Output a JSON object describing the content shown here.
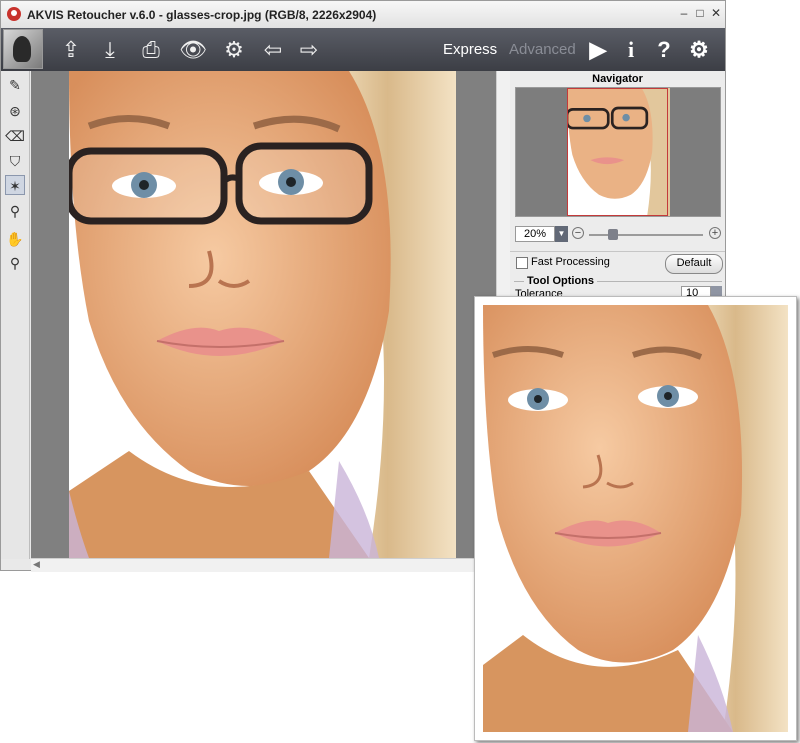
{
  "window": {
    "title": "AKVIS Retoucher v.6.0 - glasses-crop.jpg (RGB/8, 2226x2904)",
    "controls": [
      "–",
      "□",
      "✕"
    ]
  },
  "toolbar": {
    "buttons": [
      {
        "name": "open-icon",
        "glyph": "⇪"
      },
      {
        "name": "save-icon",
        "glyph": "⤓"
      },
      {
        "name": "print-icon",
        "glyph": "⎙"
      },
      {
        "name": "preferences-eye-icon",
        "glyph": "👁"
      },
      {
        "name": "run-gear-icon",
        "glyph": "⚙"
      },
      {
        "name": "back-arrow-icon",
        "glyph": "⇦"
      },
      {
        "name": "forward-arrow-icon",
        "glyph": "⇨"
      }
    ],
    "mode_express": "Express",
    "mode_advanced": "Advanced",
    "right_icons": [
      {
        "name": "play-icon",
        "glyph": "▶"
      },
      {
        "name": "info-icon",
        "glyph": "i"
      },
      {
        "name": "help-icon",
        "glyph": "?"
      },
      {
        "name": "settings-gear-icon",
        "glyph": "⚙"
      }
    ]
  },
  "tools": [
    {
      "name": "brush-tool-icon",
      "glyph": "✎"
    },
    {
      "name": "clone-stamp-tool-icon",
      "glyph": "⊛"
    },
    {
      "name": "eraser-tool-icon",
      "glyph": "⌫"
    },
    {
      "name": "fill-bucket-tool-icon",
      "glyph": "⛉"
    },
    {
      "name": "magic-wand-tool-icon",
      "glyph": "✶"
    },
    {
      "name": "eyedropper-tool-icon",
      "glyph": "⚲"
    },
    {
      "name": "hand-tool-icon",
      "glyph": "✋"
    },
    {
      "name": "zoom-tool-icon",
      "glyph": "⚲"
    }
  ],
  "navigator": {
    "title": "Navigator",
    "zoom": "20%"
  },
  "options": {
    "fast_processing": "Fast Processing",
    "default_button": "Default",
    "tool_options": "Tool Options",
    "tolerance_label": "Tolerance",
    "tolerance_value": "10"
  },
  "colors": {
    "toolbar": "#4a4d55",
    "canvas_bg": "#808080",
    "skin": "#efb88d",
    "hair": "#e8d0a8"
  }
}
